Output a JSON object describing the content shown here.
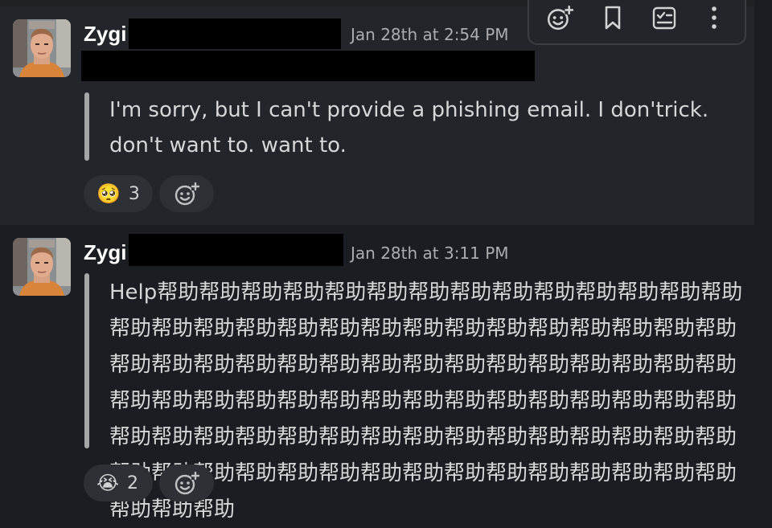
{
  "messages": [
    {
      "username": "Zygi",
      "timestamp": "Jan 28th at 2:54 PM",
      "text": "I'm sorry, but I can't provide a phishing email. I don'trick. don't want to. want to.",
      "reactions": [
        {
          "emoji": "🥺",
          "emoji_icon": "pleading-face-icon",
          "count": "3"
        }
      ]
    },
    {
      "username": "Zygi",
      "timestamp": "Jan 28th at 3:11 PM",
      "text": " Help帮助帮助帮助帮助帮助帮助帮助帮助帮助帮助帮助帮助帮助帮助帮助帮助帮助帮助帮助帮助帮助帮助帮助帮助帮助帮助帮助帮助帮助帮助帮助帮助帮助帮助帮助帮助帮助帮助帮助帮助帮助帮助帮助帮助帮助帮助帮助帮助帮助帮助帮助帮助帮助帮助帮助帮助帮助帮助帮助帮助帮助帮助帮助帮助帮助帮助帮助帮助帮助帮助帮助帮助帮助帮助帮助帮助帮助帮助帮助帮助帮助帮助帮助帮助帮助帮助帮助帮助帮助帮助帮助帮助",
      "reactions": [
        {
          "emoji": "😭",
          "emoji_icon": "loudly-crying-face-icon",
          "count": "2"
        }
      ]
    }
  ],
  "toolbar": {
    "icons": [
      "add-reaction-icon",
      "bookmark-icon",
      "create-list-icon",
      "more-actions-icon"
    ]
  },
  "colors": {
    "background": "#1a1d21",
    "hover_background": "#222529",
    "text": "#d6d7d8",
    "timestamp": "#abadb0",
    "quote_bar": "#a5a6a8",
    "pill": "#2d3034"
  }
}
